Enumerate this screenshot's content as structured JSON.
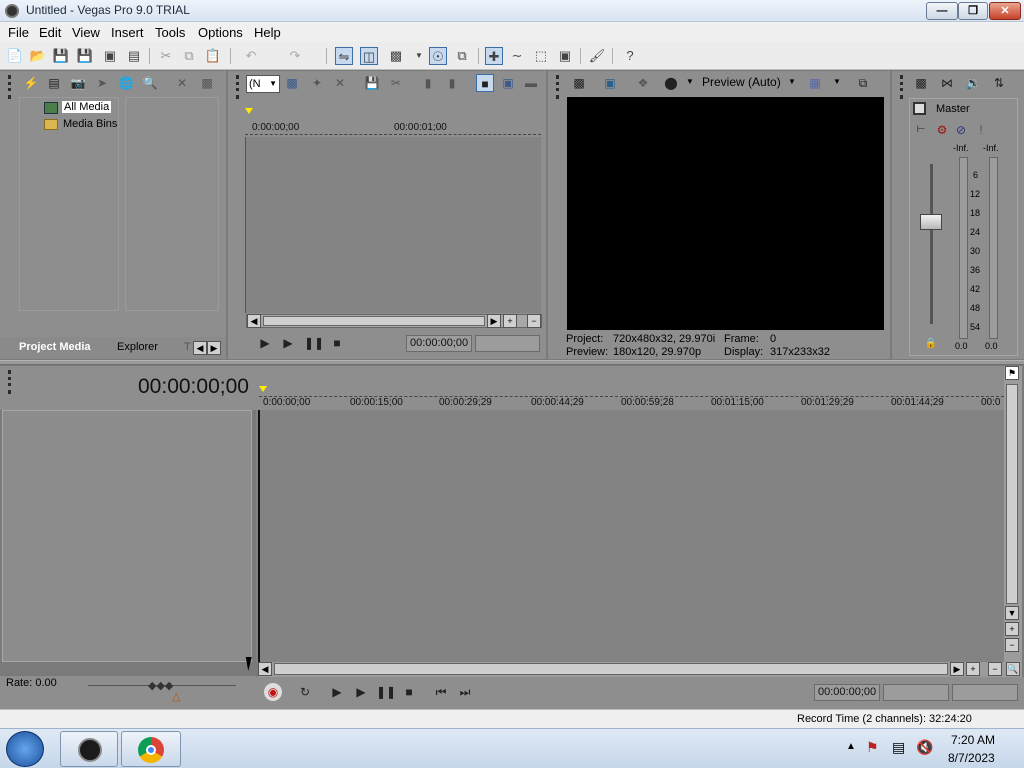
{
  "window": {
    "title": "Untitled - Vegas Pro 9.0 TRIAL",
    "min": "—",
    "max": "❐",
    "close": "✕"
  },
  "menu": [
    "File",
    "Edit",
    "View",
    "Insert",
    "Tools",
    "Options",
    "Help"
  ],
  "project_media": {
    "tree": [
      "All Media",
      "Media Bins"
    ],
    "tabs": [
      "Project Media",
      "Explorer",
      "T"
    ]
  },
  "trimmer": {
    "dropdown": "(N",
    "ruler": [
      "0:00:00;00",
      "00:00:01;00"
    ],
    "timecode": "00:00:00;00"
  },
  "preview": {
    "mode": "Preview (Auto)",
    "project_label": "Project:",
    "project_value": "720x480x32, 29.970i",
    "frame_label": "Frame:",
    "frame_value": "0",
    "preview_label": "Preview:",
    "preview_value": "180x120, 29.970p",
    "display_label": "Display:",
    "display_value": "317x233x32"
  },
  "mixer": {
    "master": "Master",
    "inf_left": "-Inf.",
    "inf_right": "-Inf.",
    "scale": [
      "6",
      "12",
      "18",
      "24",
      "30",
      "36",
      "42",
      "48",
      "54"
    ],
    "value_left": "0.0",
    "value_right": "0.0"
  },
  "timeline": {
    "timecode": "00:00:00;00",
    "ruler": [
      "0:00:00;00",
      "00:00:15;00",
      "00:00:29;29",
      "00:00:44;29",
      "00:00:59;28",
      "00:01:15;00",
      "00:01:29;29",
      "00:01:44;29",
      "00:0"
    ],
    "rate": "Rate: 0.00",
    "transport_timecode": "00:00:00;00",
    "record_time": "Record Time (2 channels): 32:24:20"
  },
  "taskbar": {
    "time": "7:20 AM",
    "date": "8/7/2023"
  }
}
